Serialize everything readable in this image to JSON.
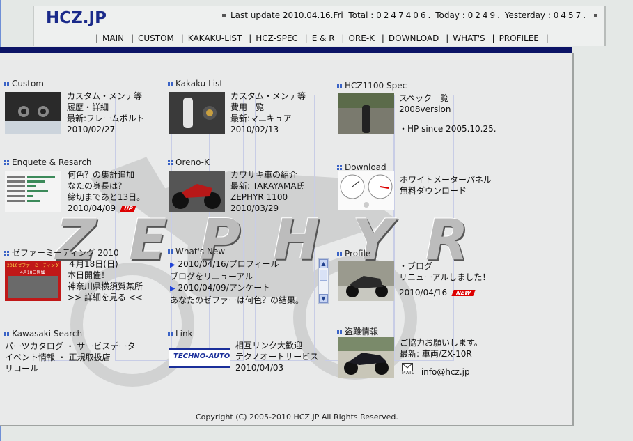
{
  "header": {
    "logo": "HCZ.JP",
    "last_update_label": "Last update",
    "last_update_value": "2010.04.16.Fri",
    "total_label": "Total :",
    "total_value": "0247406.",
    "today_label": "Today :",
    "today_value": "0249.",
    "yesterday_label": "Yesterday :",
    "yesterday_value": "0457."
  },
  "nav": [
    "MAIN",
    "CUSTOM",
    "KAKAKU-LIST",
    "HCZ-SPEC",
    "E & R",
    "ORE-K",
    "DOWNLOAD",
    "WHAT'S",
    "PROFILEE"
  ],
  "watermark": "ZEPHYR",
  "sections": {
    "custom": {
      "title": "Custom",
      "lines": [
        "カスタム・メンテ等",
        "履歴・詳細",
        "最新:フレームボルト",
        "2010/02/27"
      ]
    },
    "kakaku": {
      "title": "Kakaku List",
      "lines": [
        "カスタム・メンテ等",
        "費用一覧",
        "最新:マニキュア",
        "2010/02/13"
      ]
    },
    "spec": {
      "title": "HCZ1100 Spec",
      "lines": [
        "スペック一覧",
        "2008version",
        "",
        "・HP since 2005.10.25."
      ]
    },
    "enquete": {
      "title": "Enquete & Resarch",
      "lines": [
        "何色？の集計追加",
        "なたの身長は？",
        "締切まであと13日。",
        "2010/04/09"
      ],
      "badge": "UP"
    },
    "orenok": {
      "title": "Oreno-K",
      "lines": [
        "カワサキ車の紹介",
        "最新: TAKAYAMA氏",
        "ZEPHYR 1100",
        "2010/03/29"
      ]
    },
    "download": {
      "title": "Download",
      "lines": [
        "ホワイトメーターパネル",
        "無料ダウンロード"
      ]
    },
    "meeting": {
      "title": "ゼファーミーティング 2010",
      "lines": [
        "４月18日(日)",
        "本日開催！",
        "神奈川県横須賀某所",
        ">> 詳細を見る <<"
      ],
      "poster_text": "2010ゼファーミーティング",
      "poster_sub": "4月18日開催"
    },
    "whatsnew": {
      "title": "What's New",
      "items": [
        "2010/04/16/プロフィール",
        "ブログをリニューアル",
        "2010/04/09/アンケート",
        "あなたのゼファーは何色？の結果。"
      ]
    },
    "profile": {
      "title": "Profile",
      "lines": [
        "・ブログ",
        "リニューアルしました！",
        "2010/04/16"
      ],
      "badge": "NEW"
    },
    "kawasaki": {
      "title": "Kawasaki Search",
      "lines": [
        "パーツカタログ ・ サービスデータ",
        "イベント情報 ・ 正規取扱店",
        "リコール"
      ]
    },
    "link": {
      "title": "Link",
      "banner": "TECHNO-AUTO",
      "lines": [
        "相互リンク大歓迎",
        "テクノオートサービス",
        "2010/04/03"
      ]
    },
    "theft": {
      "title": "盗難情報",
      "lines": [
        "ご協力お願いします。",
        "最新: 車両/ZX-10R"
      ],
      "mail_label": "MAIL",
      "email": "info@hcz.jp"
    }
  },
  "footer": {
    "copyright": "Copyright (C) 2005-2010 HCZ.JP All Rights Reserved."
  },
  "colors": {
    "navy": "#0c1466",
    "logo": "#1a2a8a",
    "badge": "#dd0000",
    "arrow": "#2144d8"
  }
}
